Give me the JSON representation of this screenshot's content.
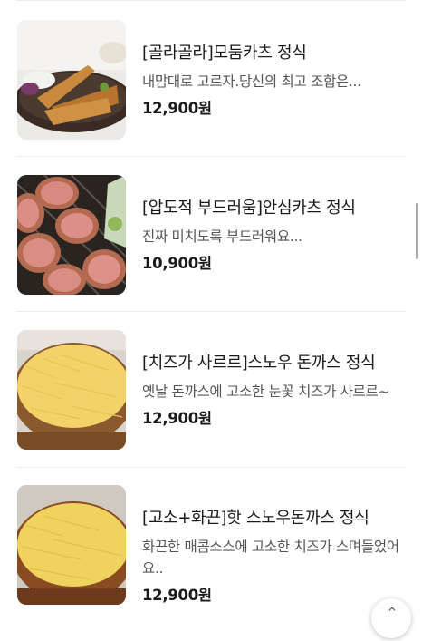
{
  "menu": {
    "items": [
      {
        "title": "[골라골라]모둠카츠 정식",
        "description": "내맘대로 고르자.당신의 최고 조합은...",
        "price": "12,900원",
        "image": "mixed-katsu-photo"
      },
      {
        "title": "[압도적 부드러움]안심카츠 정식",
        "description": "진짜 미치도록 부드러워요...",
        "price": "10,900원",
        "image": "tenderloin-katsu-photo"
      },
      {
        "title": "[치즈가 사르르]스노우 돈까스 정식",
        "description": "옛날 돈까스에 고소한 눈꽃 치즈가 사르르~",
        "price": "12,900원",
        "image": "snow-cheese-katsu-photo"
      },
      {
        "title": "[고소+화끈]핫 스노우돈까스 정식",
        "description": "화끈한 매콤소스에 고소한 치즈가 스며들었어요..",
        "price": "12,900원",
        "image": "hot-snow-katsu-photo"
      }
    ]
  },
  "fab": {
    "icon": "chevron-up-icon",
    "glyph": "^"
  }
}
